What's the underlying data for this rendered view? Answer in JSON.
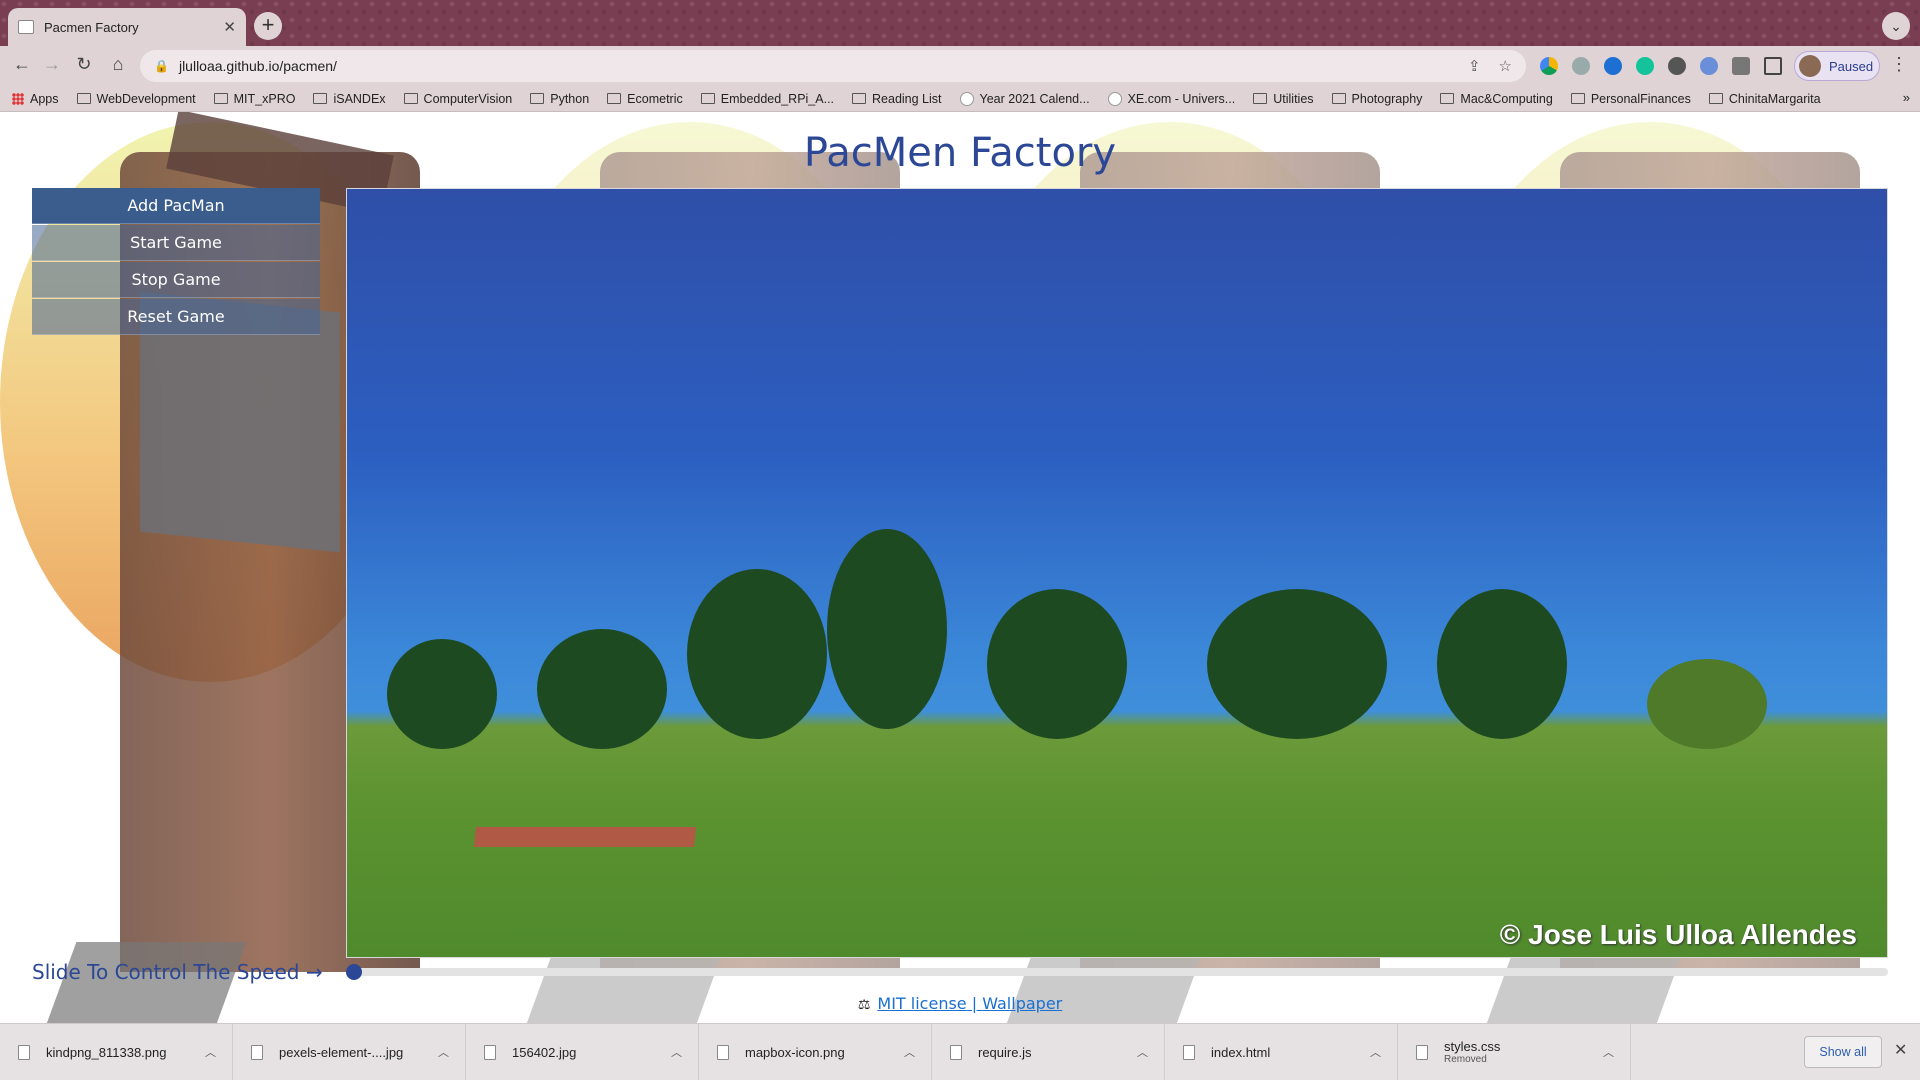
{
  "browser": {
    "tab_title": "Pacmen Factory",
    "tab_close": "✕",
    "new_tab": "+",
    "tab_menu": "⌄",
    "url": "jlulloaa.github.io/pacmen/",
    "profile_label": "Paused",
    "bookmarks": [
      {
        "label": "Apps",
        "icon": "apps-grid-icon"
      },
      {
        "label": "WebDevelopment",
        "icon": "folder-icon"
      },
      {
        "label": "MIT_xPRO",
        "icon": "folder-icon"
      },
      {
        "label": "iSANDEx",
        "icon": "folder-icon"
      },
      {
        "label": "ComputerVision",
        "icon": "folder-icon"
      },
      {
        "label": "Python",
        "icon": "folder-icon"
      },
      {
        "label": "Ecometric",
        "icon": "folder-icon"
      },
      {
        "label": "Embedded_RPi_A...",
        "icon": "folder-icon"
      },
      {
        "label": "Reading List",
        "icon": "folder-icon"
      },
      {
        "label": "Year 2021 Calend...",
        "icon": "calendar-site-icon"
      },
      {
        "label": "XE.com - Univers...",
        "icon": "xe-site-icon"
      },
      {
        "label": "Utilities",
        "icon": "folder-icon"
      },
      {
        "label": "Photography",
        "icon": "folder-icon"
      },
      {
        "label": "Mac&Computing",
        "icon": "folder-icon"
      },
      {
        "label": "PersonalFinances",
        "icon": "folder-icon"
      },
      {
        "label": "ChinitaMargarita",
        "icon": "folder-icon"
      }
    ],
    "bookmarks_overflow": "»"
  },
  "page": {
    "title": "PacMen Factory",
    "buttons": {
      "add": "Add PacMan",
      "start": "Start Game",
      "stop": "Stop Game",
      "reset": "Reset Game"
    },
    "speed_label": "Slide To Control The Speed →",
    "speed_value_fraction": 0.0,
    "photo_credit": "© Jose Luis Ulloa Allendes",
    "footer": {
      "scale_icon": "⚖",
      "license_link": "MIT license",
      "separator": " | ",
      "wallpaper_link": "Wallpaper"
    }
  },
  "downloads": {
    "items": [
      {
        "name": "kindpng_811338.png",
        "sub": ""
      },
      {
        "name": "pexels-element-....jpg",
        "sub": ""
      },
      {
        "name": "156402.jpg",
        "sub": ""
      },
      {
        "name": "mapbox-icon.png",
        "sub": ""
      },
      {
        "name": "require.js",
        "sub": ""
      },
      {
        "name": "index.html",
        "sub": ""
      },
      {
        "name": "styles.css",
        "sub": "Removed"
      }
    ],
    "show_all": "Show all",
    "close": "✕"
  },
  "colors": {
    "tabstrip": "#7a3e52",
    "chrome": "#dfd3d6",
    "title_blue": "#2b4796",
    "link_blue": "#1a6fd0",
    "button_primary": "#3b5d8d"
  }
}
